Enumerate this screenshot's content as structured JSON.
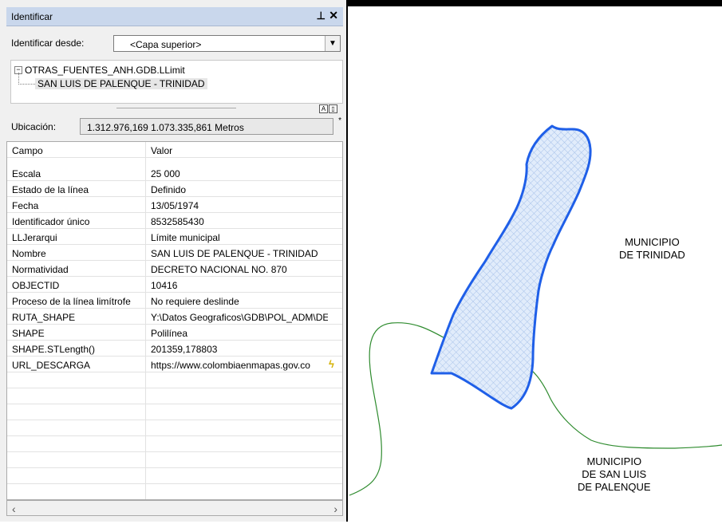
{
  "panel": {
    "title": "Identificar",
    "pin_icon": "⊥",
    "close_icon": "✕",
    "identify_from_label": "Identificar desde:",
    "identify_from_value": "<Capa superior>",
    "tree": {
      "layer": "OTRAS_FUENTES_ANH.GDB.LLimit",
      "feature": "SAN LUIS DE PALENQUE - TRINIDAD"
    },
    "location_label": "Ubicación:",
    "location_value": "1.312.976,169  1.073.335,861 Metros",
    "table": {
      "headers": [
        "Campo",
        "Valor"
      ],
      "rows": [
        [
          "Escala",
          "25 000"
        ],
        [
          "Estado de la línea",
          "Definido"
        ],
        [
          "Fecha",
          "13/05/1974"
        ],
        [
          "Identificador único",
          "8532585430"
        ],
        [
          "LLJerarqui",
          "Límite municipal"
        ],
        [
          "Nombre",
          "SAN LUIS DE PALENQUE - TRINIDAD"
        ],
        [
          "Normatividad",
          "DECRETO NACIONAL NO. 870"
        ],
        [
          "OBJECTID",
          "10416"
        ],
        [
          "Proceso de la línea limítrofe",
          "No requiere deslinde"
        ],
        [
          "RUTA_SHAPE",
          "Y:\\Datos Geograficos\\GDB\\POL_ADM\\DES"
        ],
        [
          "SHAPE",
          "Polilínea"
        ],
        [
          "SHAPE.STLength()",
          "201359,178803"
        ],
        [
          "URL_DESCARGA",
          "https://www.colombiaenmapas.gov.co"
        ]
      ]
    }
  },
  "map": {
    "label_trinidad": [
      "MUNICIPIO",
      "DE TRINIDAD"
    ],
    "label_san_luis": [
      "MUNICIPIO",
      "DE SAN LUIS",
      "DE PALENQUE"
    ],
    "colors": {
      "polygon_outline": "#1f5fe8",
      "polygon_fill": "#dbe8fb",
      "boundary_line": "#2e8b2e"
    }
  }
}
